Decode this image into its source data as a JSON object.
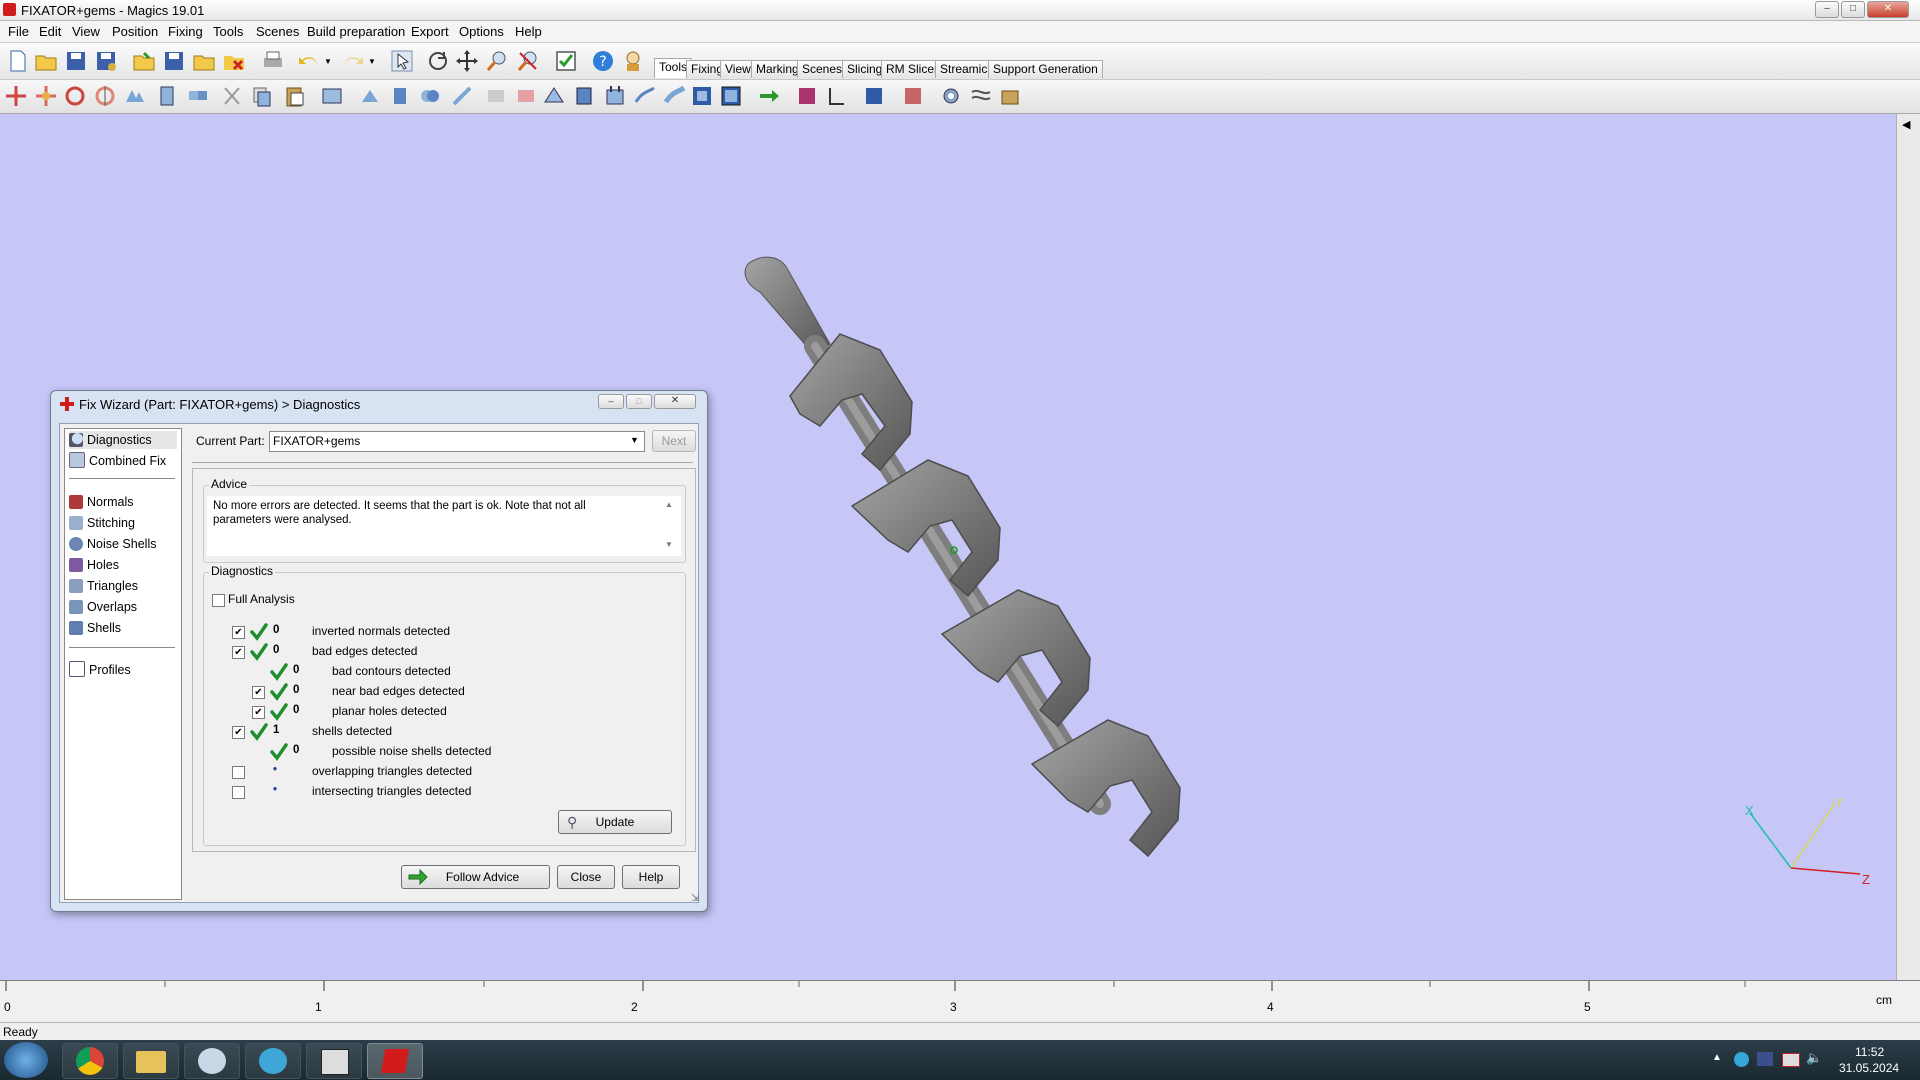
{
  "window": {
    "title": "FIXATOR+gems - Magics 19.01"
  },
  "menu": [
    "File",
    "Edit",
    "View",
    "Position",
    "Fixing",
    "Tools",
    "Scenes",
    "Build preparation",
    "Export",
    "Options",
    "Help"
  ],
  "tabs": [
    "Tools",
    "Fixing",
    "View",
    "Marking",
    "Scenes",
    "Slicing",
    "RM Slicer",
    "Streamics",
    "Support Generation"
  ],
  "dialog": {
    "title": "Fix Wizard (Part: FIXATOR+gems) > Diagnostics",
    "nav": {
      "top": [
        "Diagnostics",
        "Combined Fix"
      ],
      "tools": [
        "Normals",
        "Stitching",
        "Noise Shells",
        "Holes",
        "Triangles",
        "Overlaps",
        "Shells"
      ],
      "bottom": [
        "Profiles"
      ]
    },
    "current_part_label": "Current Part:",
    "current_part_value": "FIXATOR+gems",
    "next_label": "Next",
    "advice_label": "Advice",
    "advice_text": "No more errors are detected. It seems that the part is ok. Note that not all parameters were analysed.",
    "diagnostics_label": "Diagnostics",
    "full_analysis_label": "Full Analysis",
    "rows": [
      {
        "checked": true,
        "ok": true,
        "value": "0",
        "label": "inverted normals detected",
        "indent": 0
      },
      {
        "checked": true,
        "ok": true,
        "value": "0",
        "label": "bad edges detected",
        "indent": 0
      },
      {
        "checked": null,
        "ok": true,
        "value": "0",
        "label": "bad contours detected",
        "indent": 1
      },
      {
        "checked": true,
        "ok": true,
        "value": "0",
        "label": "near bad edges detected",
        "indent": 1
      },
      {
        "checked": true,
        "ok": true,
        "value": "0",
        "label": "planar holes detected",
        "indent": 1
      },
      {
        "checked": true,
        "ok": true,
        "value": "1",
        "label": "shells detected",
        "indent": 0
      },
      {
        "checked": null,
        "ok": true,
        "value": "0",
        "label": "possible noise shells detected",
        "indent": 1
      },
      {
        "checked": false,
        "ok": false,
        "value": "•",
        "label": "overlapping triangles detected",
        "indent": 0
      },
      {
        "checked": false,
        "ok": false,
        "value": "•",
        "label": "intersecting triangles detected",
        "indent": 0
      }
    ],
    "update_label": "Update",
    "follow_advice_label": "Follow Advice",
    "close_label": "Close",
    "help_label": "Help"
  },
  "ruler": {
    "ticks": [
      "0",
      "1",
      "2",
      "3",
      "4",
      "5"
    ],
    "unit": "cm"
  },
  "axes": {
    "x": "X",
    "y": "Y",
    "z": "Z"
  },
  "status": "Ready",
  "taskbar": {
    "time": "11:52",
    "date": "31.05.2024"
  }
}
